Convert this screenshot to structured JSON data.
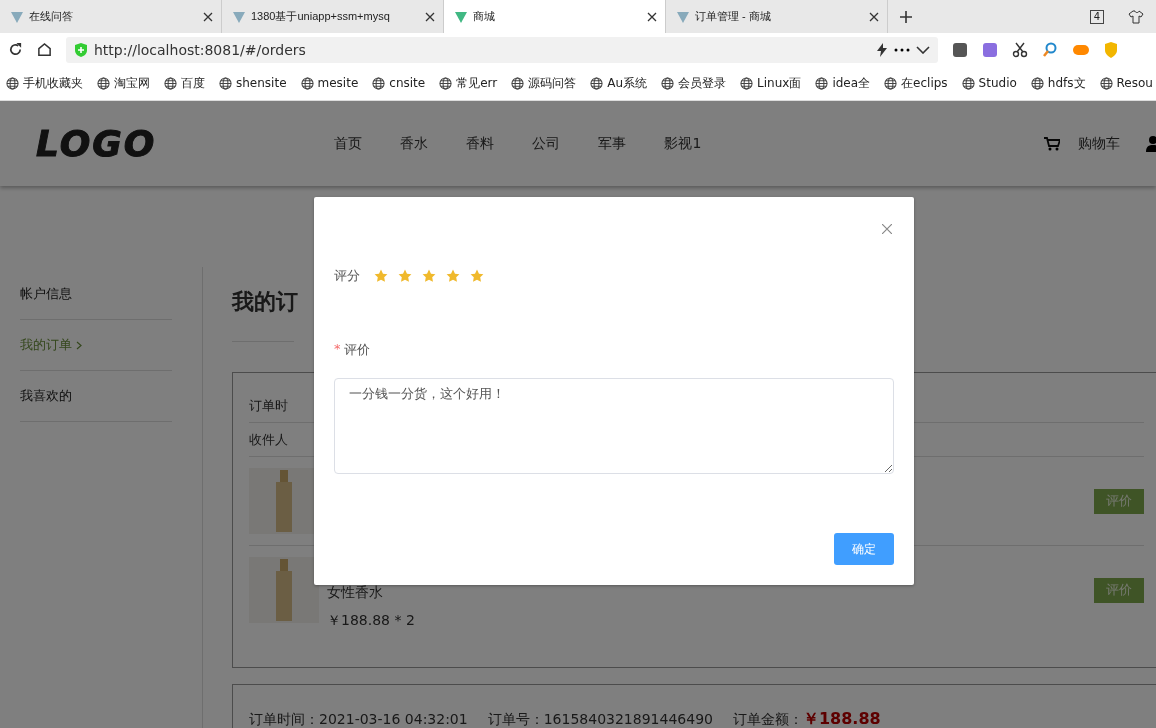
{
  "browser": {
    "tabs": [
      {
        "title": "在线问答",
        "selected": false
      },
      {
        "title": "1380基于uniapp+ssm+mysq",
        "selected": false
      },
      {
        "title": "商城",
        "selected": true
      },
      {
        "title": "订单管理 - 商城",
        "selected": false
      }
    ],
    "tab_count": "4",
    "address": "http://localhost:8081/#/orders",
    "bookmarks": [
      "手机收藏夹",
      "淘宝网",
      "百度",
      "shensite",
      "mesite",
      "cnsite",
      "常见err",
      "源码问答",
      "Au系统",
      "会员登录",
      "Linux面",
      "idea全",
      "在eclips",
      "Studio",
      "hdfs文",
      "Resou"
    ]
  },
  "header": {
    "logo": "LOGO",
    "nav": [
      "首页",
      "香水",
      "香料",
      "公司",
      "军事",
      "影视1"
    ],
    "cart": "购物车"
  },
  "sidebar": {
    "items": [
      {
        "label": "帐户信息",
        "selected": false
      },
      {
        "label": "我的订单",
        "selected": true
      },
      {
        "label": "我喜欢的",
        "selected": false
      }
    ]
  },
  "main": {
    "title": "我的订",
    "orders": [
      {
        "time": "订单时",
        "receiver": "收件人",
        "items": [
          {
            "review_button": "评价"
          },
          {
            "name": "女性香水",
            "price": "￥188.88 * 2",
            "review_button": "评价"
          }
        ]
      },
      {
        "time": "订单时间：2021-03-16 04:32:01",
        "number": "订单号：1615840321891446490",
        "amount_label": "订单金额：",
        "amount": "￥188.88"
      }
    ]
  },
  "dialog": {
    "rating_label": "评分",
    "stars": 5,
    "comment_label": "评价",
    "required_mark": "*",
    "comment": "一分钱一分货，这个好用！",
    "confirm": "确定"
  }
}
